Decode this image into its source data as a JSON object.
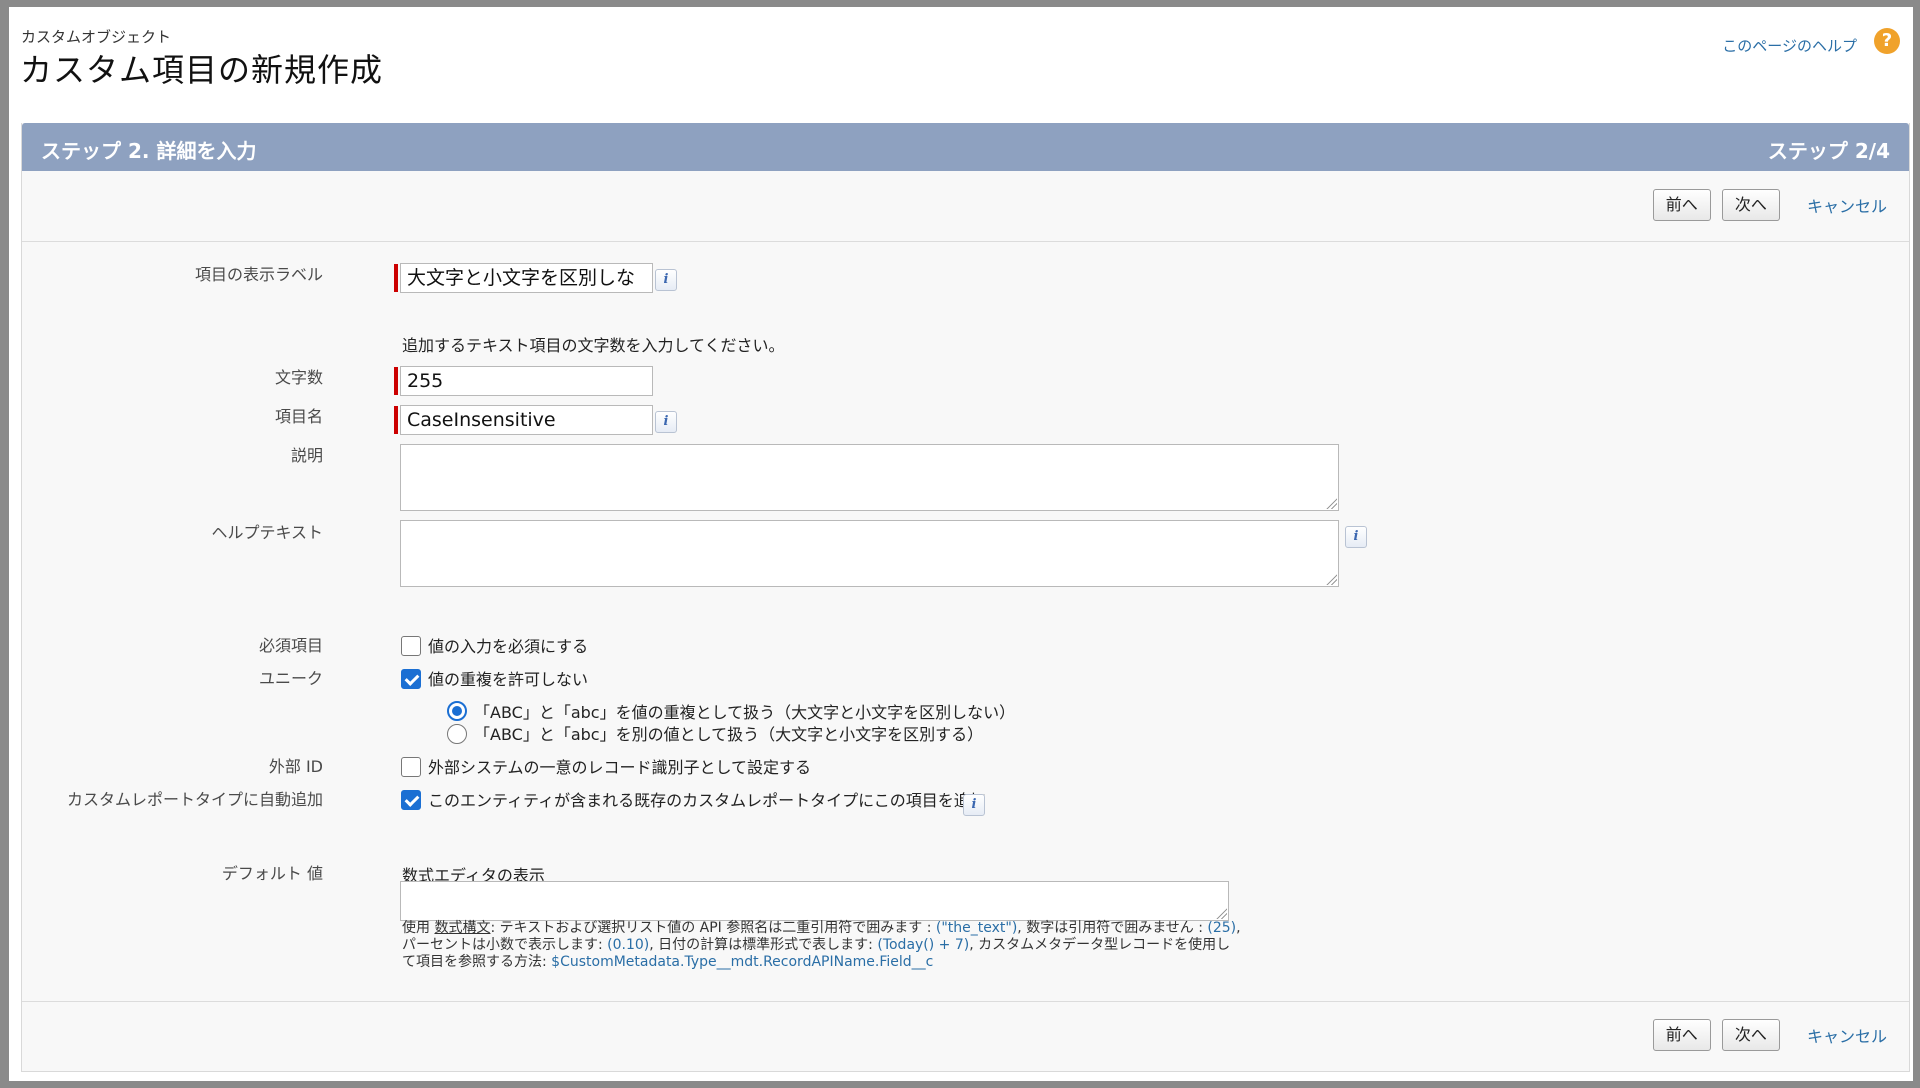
{
  "header": {
    "object_label": "カスタムオブジェクト",
    "title": "カスタム項目の新規作成",
    "help_link": "このページのヘルプ",
    "help_icon": "?"
  },
  "step": {
    "title": "ステップ 2. 詳細を入力",
    "count": "ステップ 2/4"
  },
  "buttons": {
    "prev": "前へ",
    "next": "次へ",
    "cancel": "キャンセル"
  },
  "form": {
    "field_label": {
      "label": "項目の表示ラベル",
      "value": "大文字と小文字を区別しな"
    },
    "length_hint": "追加するテキスト項目の文字数を入力してください。",
    "length": {
      "label": "文字数",
      "value": "255"
    },
    "field_name": {
      "label": "項目名",
      "value": "CaseInsensitive"
    },
    "description": {
      "label": "説明",
      "value": ""
    },
    "help_text": {
      "label": "ヘルプテキスト",
      "value": ""
    },
    "required": {
      "label": "必須項目",
      "option": "値の入力を必須にする",
      "checked": false
    },
    "unique": {
      "label": "ユニーク",
      "option": "値の重複を許可しない",
      "checked": true,
      "radio_insensitive": "「ABC」と「abc」を値の重複として扱う（大文字と小文字を区別しない）",
      "radio_sensitive": "「ABC」と「abc」を別の値として扱う（大文字と小文字を区別する）",
      "selected": "insensitive"
    },
    "external_id": {
      "label": "外部 ID",
      "option": "外部システムの一意のレコード識別子として設定する",
      "checked": false
    },
    "report_types": {
      "label": "カスタムレポートタイプに自動追加",
      "option": "このエンティティが含まれる既存のカスタムレポートタイプにこの項目を追加",
      "checked": true
    },
    "default_value": {
      "label": "デフォルト 値",
      "formula_link": "数式エディタの表示",
      "value": "",
      "hint": {
        "p1": "使用 ",
        "syntax": "数式構文",
        "p2": ": テキストおよび選択リスト値の API 参照名は二重引用符で囲みます : ",
        "ex1": "(\"the_text\")",
        "p3": ", 数字は引用符で囲みません : ",
        "ex2": "(25)",
        "p4": ", パーセントは小数で表示します: ",
        "ex3": "(0.10)",
        "p5": ", 日付の計算は標準形式で表します: ",
        "ex4": "(Today() + 7)",
        "p6": ", カスタムメタデータ型レコードを使用して項目を参照する方法: ",
        "ex5": "$CustomMetadata.Type__mdt.RecordAPIName.Field__c"
      }
    }
  },
  "info_icon": "i"
}
